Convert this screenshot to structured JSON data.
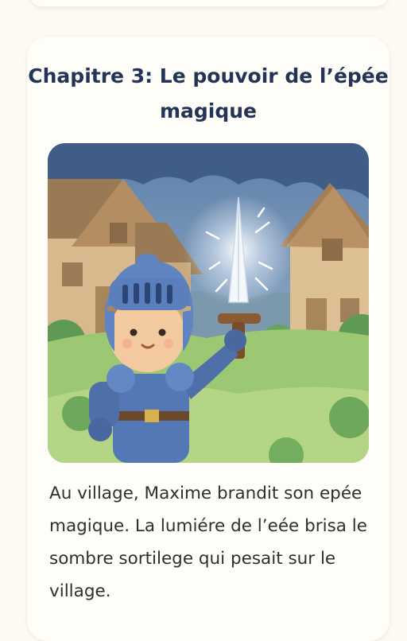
{
  "chapter": {
    "title": "Chapitre 3: Le pouvoir de l’épée magique",
    "illustration_icon": "knight-with-glowing-sword",
    "body": "Au village, Maxime brandit son epée magique. La lumiére de l’eée brisa le sombre sortilege qui pesait sur le village."
  },
  "colors": {
    "page_background": "#fcfaf3",
    "card_background": "#fffdf7",
    "title_color": "#233457",
    "text_color": "#2f2f2f"
  }
}
